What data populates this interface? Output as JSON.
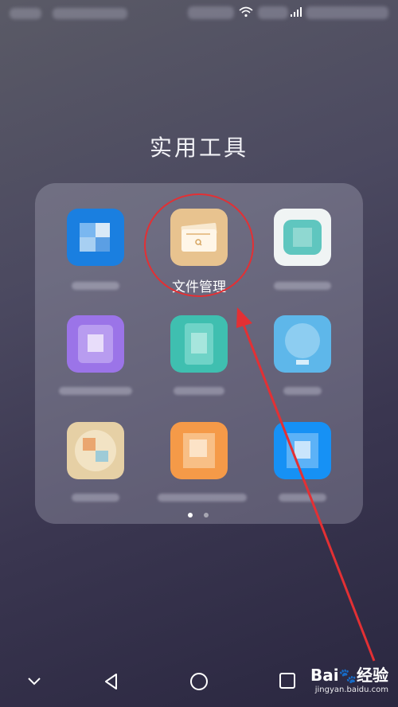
{
  "status_bar": {
    "wifi_icon": "wifi-icon",
    "signal_icon": "signal-icon"
  },
  "folder": {
    "title": "实用工具",
    "apps": [
      {
        "label": "",
        "icon": "blurred-blue-app-icon",
        "color": "#1a7fe0"
      },
      {
        "label": "文件管理",
        "icon": "file-manager-icon",
        "color": "#e8c38f"
      },
      {
        "label": "",
        "icon": "blurred-white-teal-app-icon",
        "color": "#f0f4f4"
      },
      {
        "label": "",
        "icon": "blurred-purple-app-icon",
        "color": "#9b74e8"
      },
      {
        "label": "",
        "icon": "blurred-teal-app-icon",
        "color": "#3fbfb0"
      },
      {
        "label": "",
        "icon": "blurred-light-blue-app-icon",
        "color": "#5eb7ea"
      },
      {
        "label": "",
        "icon": "blurred-beige-app-icon",
        "color": "#e6d0a5"
      },
      {
        "label": "",
        "icon": "blurred-orange-app-icon",
        "color": "#f59a48"
      },
      {
        "label": "",
        "icon": "blurred-blue-app-icon",
        "color": "#1691f5"
      }
    ],
    "page_indicator": {
      "pages": 2,
      "current": 1
    }
  },
  "annotation": {
    "highlight_color": "#e33034"
  },
  "nav_bar": {
    "buttons": [
      "collapse-icon",
      "back-icon",
      "home-icon",
      "recents-icon"
    ]
  },
  "watermark": {
    "brand": "Bai",
    "brand_tail": "经验",
    "url": "jingyan.baidu.com"
  }
}
